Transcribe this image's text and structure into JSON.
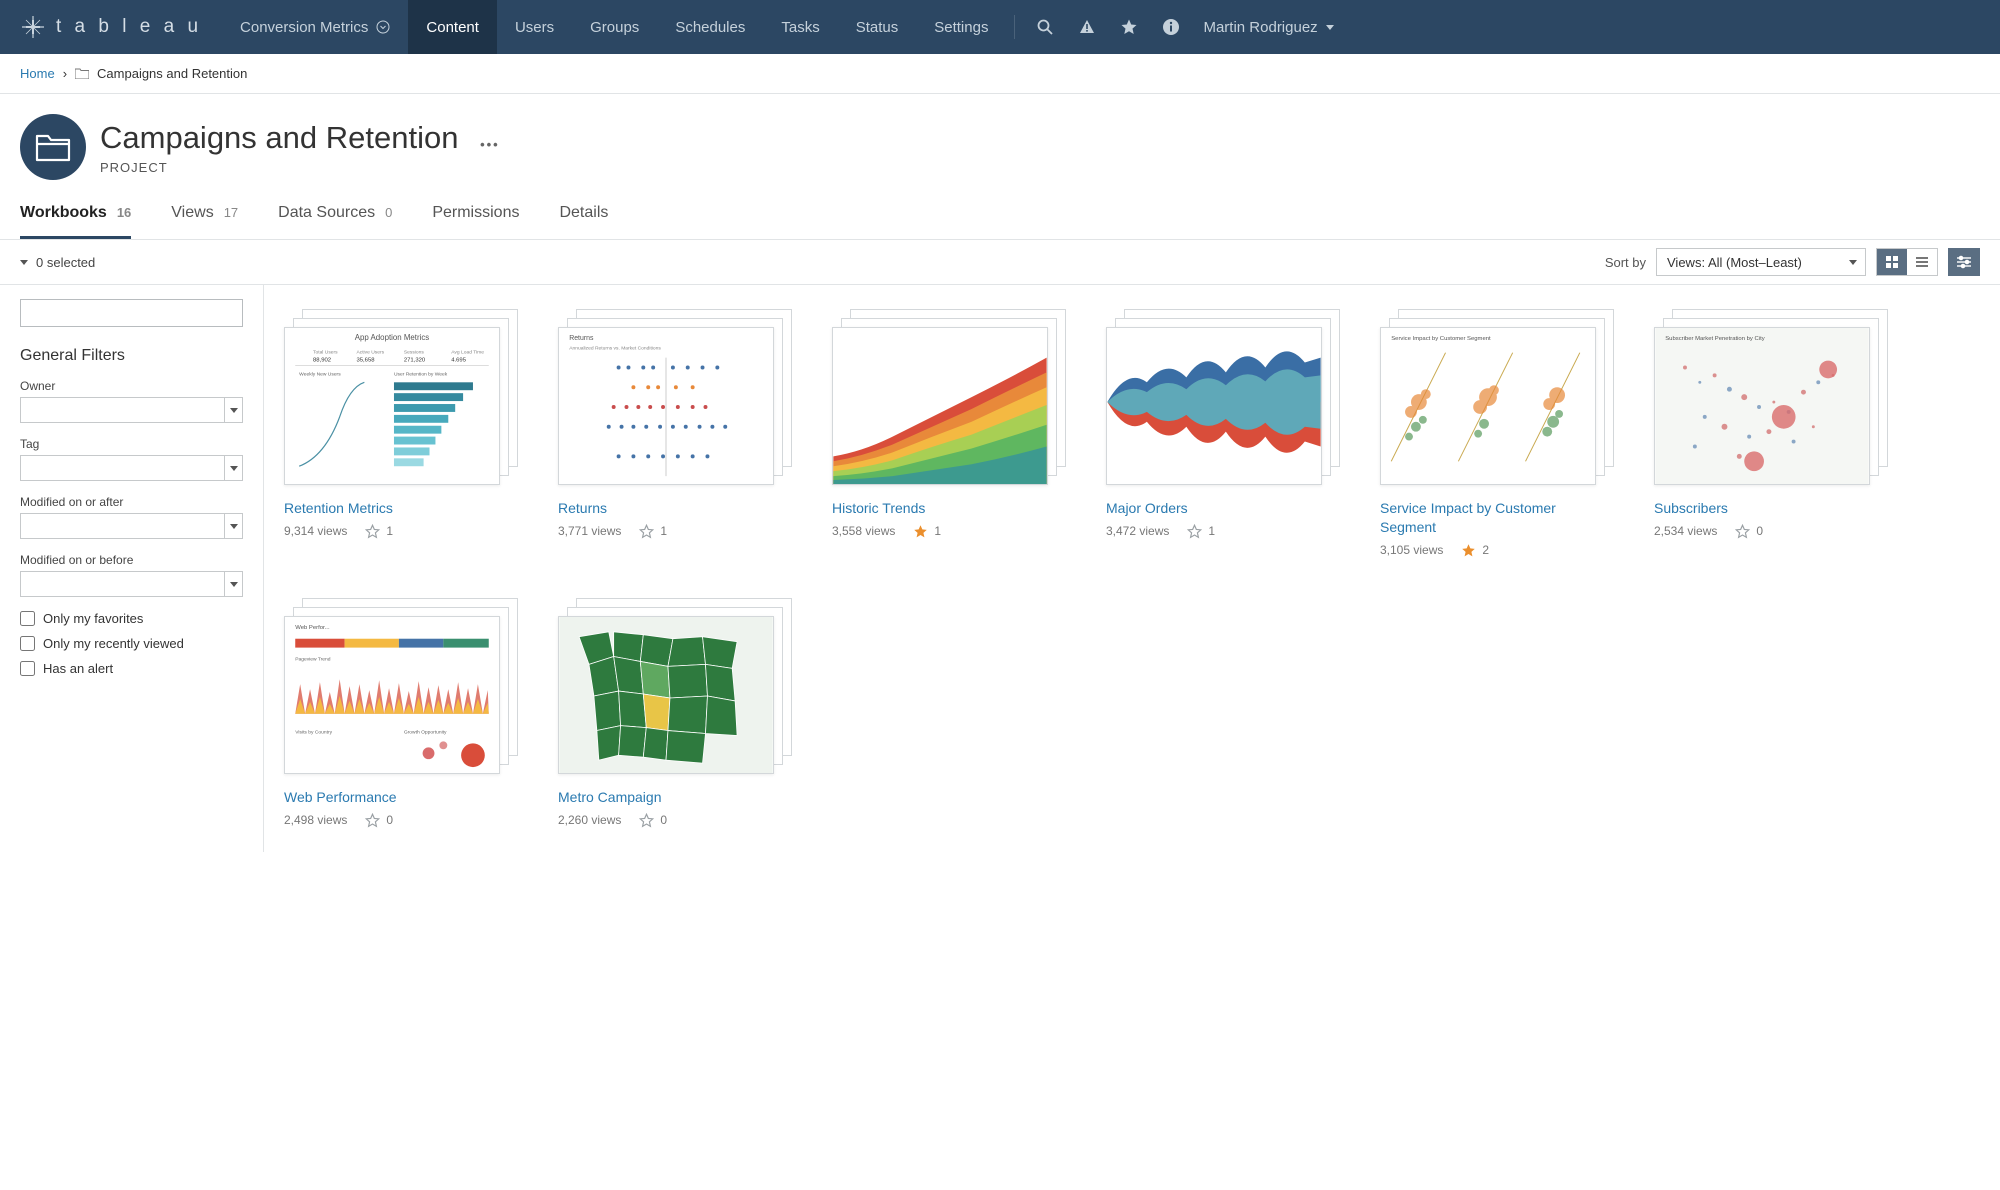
{
  "brand": "t a b l e a u",
  "site_dropdown": "Conversion Metrics",
  "nav": [
    "Content",
    "Users",
    "Groups",
    "Schedules",
    "Tasks",
    "Status",
    "Settings"
  ],
  "nav_active": "Content",
  "user": "Martin Rodriguez",
  "breadcrumb": {
    "home": "Home",
    "current": "Campaigns and Retention"
  },
  "project": {
    "title": "Campaigns and Retention",
    "subtitle": "PROJECT"
  },
  "subtabs": [
    {
      "label": "Workbooks",
      "count": "16",
      "active": true
    },
    {
      "label": "Views",
      "count": "17"
    },
    {
      "label": "Data Sources",
      "count": "0"
    },
    {
      "label": "Permissions"
    },
    {
      "label": "Details"
    }
  ],
  "selection": "0 selected",
  "sort": {
    "label": "Sort by",
    "value": "Views: All (Most–Least)"
  },
  "filters": {
    "title": "General Filters",
    "owner": "Owner",
    "tag": "Tag",
    "mod_after": "Modified on or after",
    "mod_before": "Modified on or before",
    "only_fav": "Only my favorites",
    "only_recent": "Only my recently viewed",
    "has_alert": "Has an alert"
  },
  "workbooks": [
    {
      "title": "Retention Metrics",
      "views": "9,314 views",
      "fav": "1",
      "starred": false,
      "thumb": "adoption"
    },
    {
      "title": "Returns",
      "views": "3,771 views",
      "fav": "1",
      "starred": false,
      "thumb": "dots"
    },
    {
      "title": "Historic Trends",
      "views": "3,558 views",
      "fav": "1",
      "starred": true,
      "thumb": "stackedarea"
    },
    {
      "title": "Major Orders",
      "views": "3,472 views",
      "fav": "1",
      "starred": false,
      "thumb": "mirror"
    },
    {
      "title": "Service Impact by Customer Segment",
      "views": "3,105 views",
      "fav": "2",
      "starred": true,
      "thumb": "scatter"
    },
    {
      "title": "Subscribers",
      "views": "2,534 views",
      "fav": "0",
      "starred": false,
      "thumb": "mapdots"
    },
    {
      "title": "Web Performance",
      "views": "2,498 views",
      "fav": "0",
      "starred": false,
      "thumb": "webperf"
    },
    {
      "title": "Metro Campaign",
      "views": "2,260 views",
      "fav": "0",
      "starred": false,
      "thumb": "choropleth"
    }
  ],
  "thumb_labels": {
    "adoption": "App Adoption Metrics",
    "dots": "Returns",
    "scatter": "Service Impact by Customer Segment",
    "mapdots": "Subscriber Market Penetration by City",
    "webperf": "Web Perfor..."
  }
}
